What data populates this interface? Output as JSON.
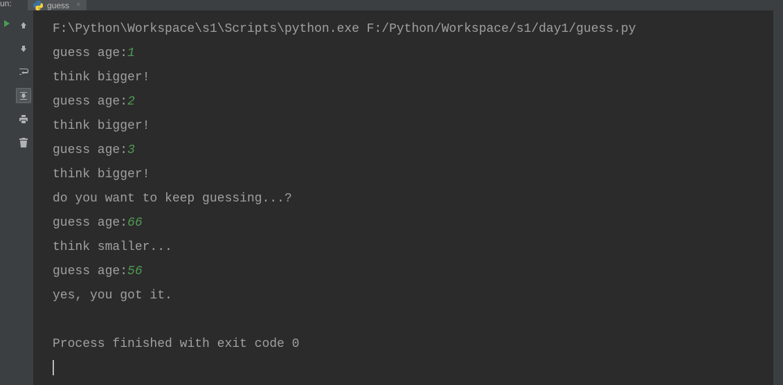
{
  "run_label": "un:",
  "tab": {
    "label": "guess",
    "close_glyph": "×"
  },
  "console": {
    "command": "F:\\Python\\Workspace\\s1\\Scripts\\python.exe F:/Python/Workspace/s1/day1/guess.py",
    "lines": [
      {
        "prompt": "guess age:",
        "input": "1"
      },
      {
        "text": "think bigger!"
      },
      {
        "prompt": "guess age:",
        "input": "2"
      },
      {
        "text": "think bigger!"
      },
      {
        "prompt": "guess age:",
        "input": "3"
      },
      {
        "text": "think bigger!"
      },
      {
        "text": "do you want to keep guessing...?"
      },
      {
        "prompt": "guess age:",
        "input": "66"
      },
      {
        "text": "think smaller..."
      },
      {
        "prompt": "guess age:",
        "input": "56"
      },
      {
        "text": "yes, you got it."
      }
    ],
    "exit_message": "Process finished with exit code 0"
  }
}
